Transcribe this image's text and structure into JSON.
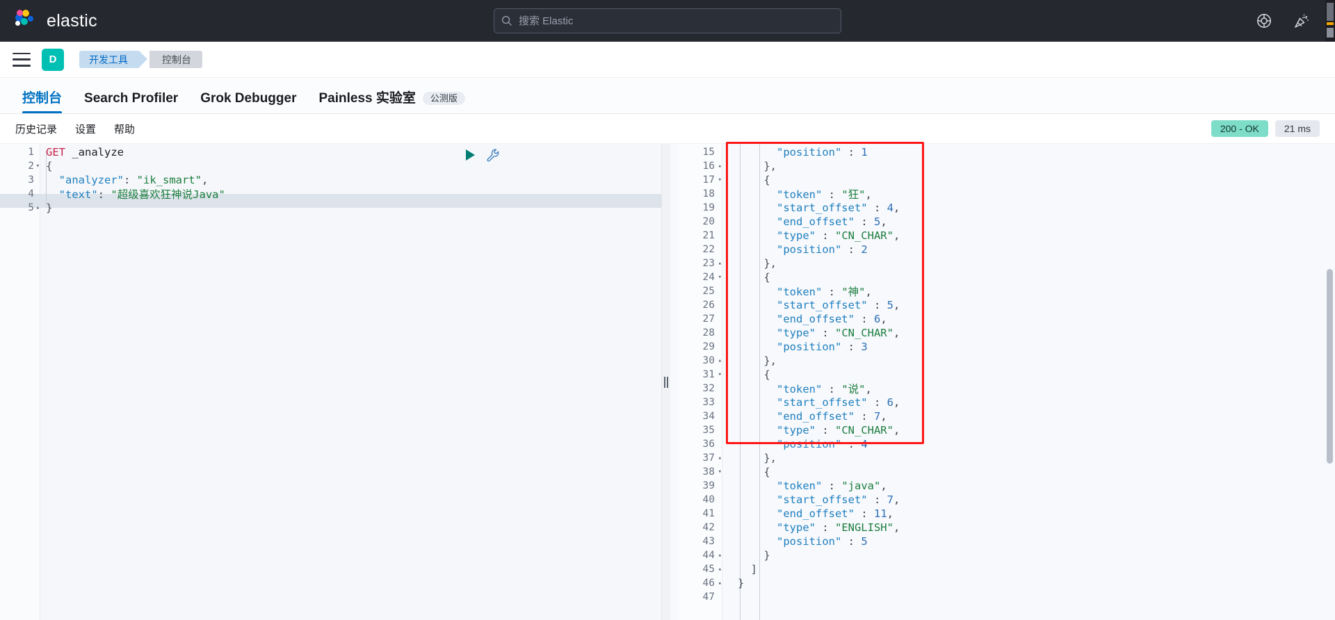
{
  "header": {
    "brand": "elastic",
    "search": {
      "placeholder": "搜索 Elastic",
      "value": "",
      "icon": "search-icon"
    },
    "icons": [
      {
        "name": "help-lifebuoy-icon",
        "label": "帮助"
      },
      {
        "name": "whats-new-party-icon",
        "label": "新功能"
      }
    ]
  },
  "breadcrumb": {
    "menu_icon": "hamburger-menu-icon",
    "space_initial": "D",
    "items": [
      {
        "label": "开发工具"
      },
      {
        "label": "控制台"
      }
    ]
  },
  "tabs": [
    {
      "label": "控制台",
      "active": true,
      "badge": ""
    },
    {
      "label": "Search Profiler",
      "active": false,
      "badge": ""
    },
    {
      "label": "Grok Debugger",
      "active": false,
      "badge": ""
    },
    {
      "label": "Painless 实验室",
      "active": false,
      "badge": "公测版"
    }
  ],
  "submenu": {
    "items": [
      {
        "label": "历史记录"
      },
      {
        "label": "设置"
      },
      {
        "label": "帮助"
      }
    ],
    "status_code": "200 - OK",
    "status_time": "21 ms"
  },
  "editor": {
    "send_button": "send-request-icon",
    "wrench_button": "wrench-icon",
    "lines": [
      {
        "n": "1",
        "fold": "",
        "tokens": [
          {
            "t": "GET",
            "c": "k-method"
          },
          {
            "t": " _analyze",
            "c": "k-path"
          }
        ]
      },
      {
        "n": "2",
        "fold": "▾",
        "tokens": [
          {
            "t": "{",
            "c": "k-brace"
          }
        ]
      },
      {
        "n": "3",
        "fold": "",
        "tokens": [
          {
            "t": "  \"analyzer\"",
            "c": "k-key"
          },
          {
            "t": ": ",
            "c": "k-punct"
          },
          {
            "t": "\"ik_smart\"",
            "c": "k-str"
          },
          {
            "t": ",",
            "c": "k-punct"
          }
        ]
      },
      {
        "n": "4",
        "fold": "",
        "tokens": [
          {
            "t": "  \"text\"",
            "c": "k-key"
          },
          {
            "t": ": ",
            "c": "k-punct"
          },
          {
            "t": "\"超级喜欢狂神说Java\"",
            "c": "k-str"
          }
        ]
      },
      {
        "n": "5",
        "fold": "▴",
        "tokens": [
          {
            "t": "}",
            "c": "k-brace"
          }
        ],
        "highlight": true
      }
    ]
  },
  "output": {
    "lines": [
      {
        "n": "15",
        "fold": "",
        "tokens": [
          {
            "t": "      \"position\"",
            "c": "k-key"
          },
          {
            "t": " : ",
            "c": "k-punct"
          },
          {
            "t": "1",
            "c": "k-num"
          }
        ]
      },
      {
        "n": "16",
        "fold": "▴",
        "tokens": [
          {
            "t": "    },",
            "c": "k-brace"
          }
        ]
      },
      {
        "n": "17",
        "fold": "▾",
        "tokens": [
          {
            "t": "    {",
            "c": "k-brace"
          }
        ]
      },
      {
        "n": "18",
        "fold": "",
        "tokens": [
          {
            "t": "      \"token\"",
            "c": "k-key"
          },
          {
            "t": " : ",
            "c": "k-punct"
          },
          {
            "t": "\"狂\"",
            "c": "k-str"
          },
          {
            "t": ",",
            "c": "k-punct"
          }
        ]
      },
      {
        "n": "19",
        "fold": "",
        "tokens": [
          {
            "t": "      \"start_offset\"",
            "c": "k-key"
          },
          {
            "t": " : ",
            "c": "k-punct"
          },
          {
            "t": "4",
            "c": "k-num"
          },
          {
            "t": ",",
            "c": "k-punct"
          }
        ]
      },
      {
        "n": "20",
        "fold": "",
        "tokens": [
          {
            "t": "      \"end_offset\"",
            "c": "k-key"
          },
          {
            "t": " : ",
            "c": "k-punct"
          },
          {
            "t": "5",
            "c": "k-num"
          },
          {
            "t": ",",
            "c": "k-punct"
          }
        ]
      },
      {
        "n": "21",
        "fold": "",
        "tokens": [
          {
            "t": "      \"type\"",
            "c": "k-key"
          },
          {
            "t": " : ",
            "c": "k-punct"
          },
          {
            "t": "\"CN_CHAR\"",
            "c": "k-str"
          },
          {
            "t": ",",
            "c": "k-punct"
          }
        ]
      },
      {
        "n": "22",
        "fold": "",
        "tokens": [
          {
            "t": "      \"position\"",
            "c": "k-key"
          },
          {
            "t": " : ",
            "c": "k-punct"
          },
          {
            "t": "2",
            "c": "k-num"
          }
        ]
      },
      {
        "n": "23",
        "fold": "▴",
        "tokens": [
          {
            "t": "    },",
            "c": "k-brace"
          }
        ]
      },
      {
        "n": "24",
        "fold": "▾",
        "tokens": [
          {
            "t": "    {",
            "c": "k-brace"
          }
        ]
      },
      {
        "n": "25",
        "fold": "",
        "tokens": [
          {
            "t": "      \"token\"",
            "c": "k-key"
          },
          {
            "t": " : ",
            "c": "k-punct"
          },
          {
            "t": "\"神\"",
            "c": "k-str"
          },
          {
            "t": ",",
            "c": "k-punct"
          }
        ]
      },
      {
        "n": "26",
        "fold": "",
        "tokens": [
          {
            "t": "      \"start_offset\"",
            "c": "k-key"
          },
          {
            "t": " : ",
            "c": "k-punct"
          },
          {
            "t": "5",
            "c": "k-num"
          },
          {
            "t": ",",
            "c": "k-punct"
          }
        ]
      },
      {
        "n": "27",
        "fold": "",
        "tokens": [
          {
            "t": "      \"end_offset\"",
            "c": "k-key"
          },
          {
            "t": " : ",
            "c": "k-punct"
          },
          {
            "t": "6",
            "c": "k-num"
          },
          {
            "t": ",",
            "c": "k-punct"
          }
        ]
      },
      {
        "n": "28",
        "fold": "",
        "tokens": [
          {
            "t": "      \"type\"",
            "c": "k-key"
          },
          {
            "t": " : ",
            "c": "k-punct"
          },
          {
            "t": "\"CN_CHAR\"",
            "c": "k-str"
          },
          {
            "t": ",",
            "c": "k-punct"
          }
        ]
      },
      {
        "n": "29",
        "fold": "",
        "tokens": [
          {
            "t": "      \"position\"",
            "c": "k-key"
          },
          {
            "t": " : ",
            "c": "k-punct"
          },
          {
            "t": "3",
            "c": "k-num"
          }
        ]
      },
      {
        "n": "30",
        "fold": "▴",
        "tokens": [
          {
            "t": "    },",
            "c": "k-brace"
          }
        ]
      },
      {
        "n": "31",
        "fold": "▾",
        "tokens": [
          {
            "t": "    {",
            "c": "k-brace"
          }
        ]
      },
      {
        "n": "32",
        "fold": "",
        "tokens": [
          {
            "t": "      \"token\"",
            "c": "k-key"
          },
          {
            "t": " : ",
            "c": "k-punct"
          },
          {
            "t": "\"说\"",
            "c": "k-str"
          },
          {
            "t": ",",
            "c": "k-punct"
          }
        ]
      },
      {
        "n": "33",
        "fold": "",
        "tokens": [
          {
            "t": "      \"start_offset\"",
            "c": "k-key"
          },
          {
            "t": " : ",
            "c": "k-punct"
          },
          {
            "t": "6",
            "c": "k-num"
          },
          {
            "t": ",",
            "c": "k-punct"
          }
        ]
      },
      {
        "n": "34",
        "fold": "",
        "tokens": [
          {
            "t": "      \"end_offset\"",
            "c": "k-key"
          },
          {
            "t": " : ",
            "c": "k-punct"
          },
          {
            "t": "7",
            "c": "k-num"
          },
          {
            "t": ",",
            "c": "k-punct"
          }
        ]
      },
      {
        "n": "35",
        "fold": "",
        "tokens": [
          {
            "t": "      \"type\"",
            "c": "k-key"
          },
          {
            "t": " : ",
            "c": "k-punct"
          },
          {
            "t": "\"CN_CHAR\"",
            "c": "k-str"
          },
          {
            "t": ",",
            "c": "k-punct"
          }
        ]
      },
      {
        "n": "36",
        "fold": "",
        "tokens": [
          {
            "t": "      \"position\"",
            "c": "k-key"
          },
          {
            "t": " : ",
            "c": "k-punct"
          },
          {
            "t": "4",
            "c": "k-num"
          }
        ]
      },
      {
        "n": "37",
        "fold": "▴",
        "tokens": [
          {
            "t": "    },",
            "c": "k-brace"
          }
        ]
      },
      {
        "n": "38",
        "fold": "▾",
        "tokens": [
          {
            "t": "    {",
            "c": "k-brace"
          }
        ]
      },
      {
        "n": "39",
        "fold": "",
        "tokens": [
          {
            "t": "      \"token\"",
            "c": "k-key"
          },
          {
            "t": " : ",
            "c": "k-punct"
          },
          {
            "t": "\"java\"",
            "c": "k-str"
          },
          {
            "t": ",",
            "c": "k-punct"
          }
        ]
      },
      {
        "n": "40",
        "fold": "",
        "tokens": [
          {
            "t": "      \"start_offset\"",
            "c": "k-key"
          },
          {
            "t": " : ",
            "c": "k-punct"
          },
          {
            "t": "7",
            "c": "k-num"
          },
          {
            "t": ",",
            "c": "k-punct"
          }
        ]
      },
      {
        "n": "41",
        "fold": "",
        "tokens": [
          {
            "t": "      \"end_offset\"",
            "c": "k-key"
          },
          {
            "t": " : ",
            "c": "k-punct"
          },
          {
            "t": "11",
            "c": "k-num"
          },
          {
            "t": ",",
            "c": "k-punct"
          }
        ]
      },
      {
        "n": "42",
        "fold": "",
        "tokens": [
          {
            "t": "      \"type\"",
            "c": "k-key"
          },
          {
            "t": " : ",
            "c": "k-punct"
          },
          {
            "t": "\"ENGLISH\"",
            "c": "k-str"
          },
          {
            "t": ",",
            "c": "k-punct"
          }
        ]
      },
      {
        "n": "43",
        "fold": "",
        "tokens": [
          {
            "t": "      \"position\"",
            "c": "k-key"
          },
          {
            "t": " : ",
            "c": "k-punct"
          },
          {
            "t": "5",
            "c": "k-num"
          }
        ]
      },
      {
        "n": "44",
        "fold": "▴",
        "tokens": [
          {
            "t": "    }",
            "c": "k-brace"
          }
        ]
      },
      {
        "n": "45",
        "fold": "▴",
        "tokens": [
          {
            "t": "  ]",
            "c": "k-brace"
          }
        ]
      },
      {
        "n": "46",
        "fold": "▴",
        "tokens": [
          {
            "t": "}",
            "c": "k-brace"
          }
        ]
      },
      {
        "n": "47",
        "fold": "",
        "tokens": [
          {
            "t": "",
            "c": "k-brace"
          }
        ]
      }
    ]
  },
  "annotation": {
    "name": "red-highlight-box",
    "color": "#ff1616"
  },
  "colors": {
    "brand_dark": "#25282f",
    "accent_blue": "#0071c2",
    "teal": "#00bfb3",
    "status_green": "#7dddc9"
  }
}
